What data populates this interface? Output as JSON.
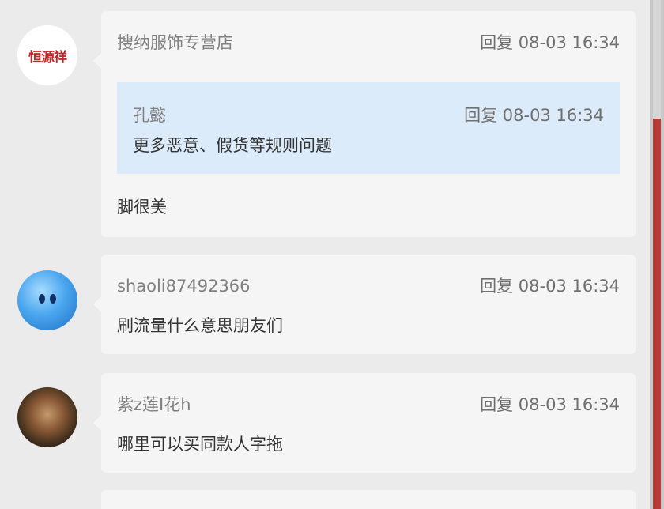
{
  "comments": [
    {
      "avatar_type": "logo",
      "avatar_logo_text": "恒源祥",
      "user": "搜纳服饰专营店",
      "reply_label": "回复",
      "time": "08-03 16:34",
      "quote": {
        "user": "孔懿",
        "reply_label": "回复",
        "time": "08-03 16:34",
        "text": "更多恶意、假货等规则问题"
      },
      "text": "脚很美"
    },
    {
      "avatar_type": "bubble",
      "user": "shaoli87492366",
      "reply_label": "回复",
      "time": "08-03 16:34",
      "text": "刷流量什么意思朋友们"
    },
    {
      "avatar_type": "photo",
      "user": "紫z莲I花h",
      "reply_label": "回复",
      "time": "08-03 16:34",
      "text": "哪里可以买同款人字拖"
    }
  ],
  "colors": {
    "background": "#ebebeb",
    "card": "#f5f5f5",
    "quote": "#dcebfa",
    "accent_strip": "#b73a35"
  }
}
